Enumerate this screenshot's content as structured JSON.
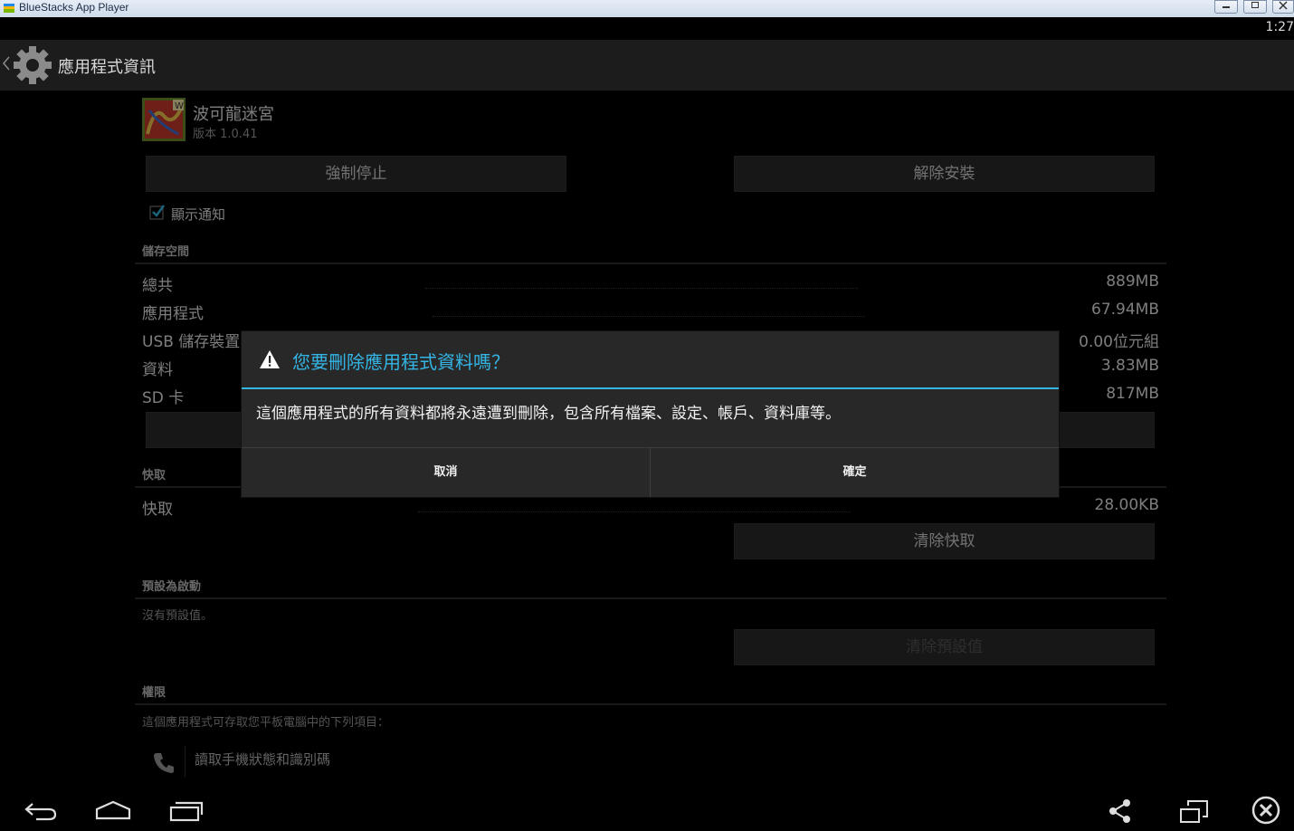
{
  "window": {
    "title": "BlueStacks App Player",
    "controls": [
      "▭",
      "◻",
      "✕"
    ]
  },
  "status": {
    "clock": "1:27"
  },
  "actionbar": {
    "title": "應用程式資訊",
    "icon": "settings-gear-icon"
  },
  "app": {
    "name": "波可龍迷宮",
    "version": "版本 1.0.41"
  },
  "buttons": {
    "force_stop": "強制停止",
    "uninstall": "解除安裝",
    "clear_cache": "清除快取",
    "clear_defaults": "清除預設值"
  },
  "notify": {
    "label": "顯示通知",
    "checked": true
  },
  "storage": {
    "header": "儲存空間",
    "rows": [
      {
        "label": "總共",
        "value": "889MB"
      },
      {
        "label": "應用程式",
        "value": "67.94MB"
      },
      {
        "label": "USB 儲存裝置",
        "value": "0.00位元組"
      },
      {
        "label": "資料",
        "value": "3.83MB"
      },
      {
        "label": "SD 卡",
        "value": "817MB"
      }
    ]
  },
  "cache": {
    "header": "快取",
    "label": "快取",
    "value": "28.00KB"
  },
  "defaults": {
    "header": "預設為啟動",
    "text": "沒有預設值。"
  },
  "permissions": {
    "header": "權限",
    "intro": "這個應用程式可存取您平板電腦中的下列項目：",
    "items": [
      {
        "label": "讀取手機狀態和識別碼",
        "icon": "phone-icon"
      }
    ]
  },
  "dialog": {
    "title": "您要刪除應用程式資料嗎？",
    "message": "這個應用程式的所有資料都將永遠遭到刪除，包含所有檔案、設定、帳戶、資料庫等。",
    "cancel": "取消",
    "confirm": "確定",
    "accent": "#33b5e5"
  },
  "navbar": {
    "left": [
      "back-icon",
      "home-icon",
      "recent-apps-icon"
    ],
    "right": [
      "share-icon",
      "rotate-screen-icon",
      "close-circle-icon"
    ]
  }
}
